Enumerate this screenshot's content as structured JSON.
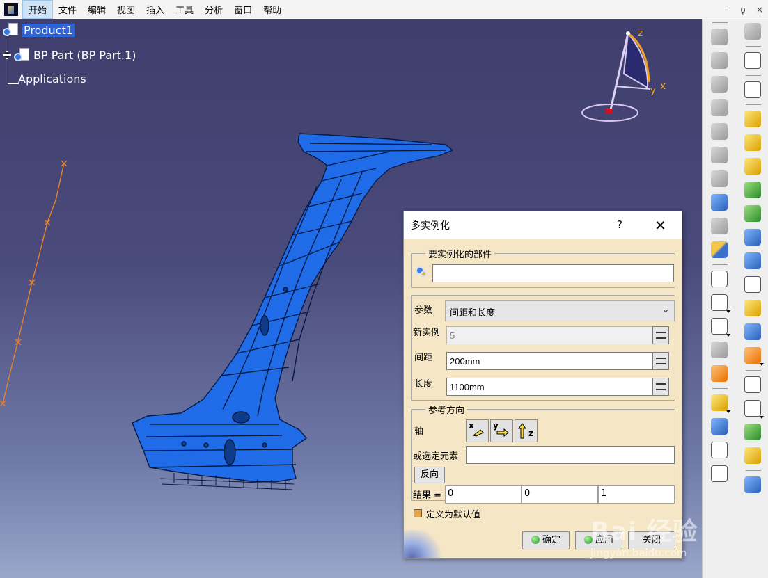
{
  "menubar": {
    "items": [
      "开始",
      "文件",
      "编辑",
      "视图",
      "插入",
      "工具",
      "分析",
      "窗口",
      "帮助"
    ],
    "active_index": 0,
    "window_controls": [
      "–",
      "ǫ",
      "×"
    ]
  },
  "tree": {
    "root": "Product1",
    "child": "BP Part (BP Part.1)",
    "applications": "Applications"
  },
  "compass": {
    "z": "z",
    "x": "x",
    "y": "y"
  },
  "dialog": {
    "title": "多实例化",
    "help": "?",
    "close": "✕",
    "part_group_label": "要实例化的部件",
    "part_value": "",
    "params_label": "参数",
    "params_selected": "间距和长度",
    "new_instances_label": "新实例",
    "new_instances_value": "5",
    "spacing_label": "间距",
    "spacing_value": "200mm",
    "length_label": "长度",
    "length_value": "1100mm",
    "ref_dir_group_label": "参考方向",
    "axis_label": "轴",
    "axis_buttons": [
      "x",
      "y",
      "z"
    ],
    "or_select_label": "或选定元素",
    "or_select_value": "",
    "reverse_button": "反向",
    "result_label": "结果 =",
    "result_values": [
      "0",
      "0",
      "1"
    ],
    "default_checkbox_label": "定义为默认值",
    "default_checked": true,
    "ok_button": "确定",
    "apply_button": "应用",
    "close_button": "关闭"
  },
  "colors": {
    "accent_blue": "#2e64d6",
    "part_blue": "#1f6be8",
    "curve_orange": "#e8822a",
    "dialog_bg": "#f5e6c6"
  },
  "watermark": {
    "text": "Bai 经验",
    "sub": "jingyan.baidu.com"
  }
}
